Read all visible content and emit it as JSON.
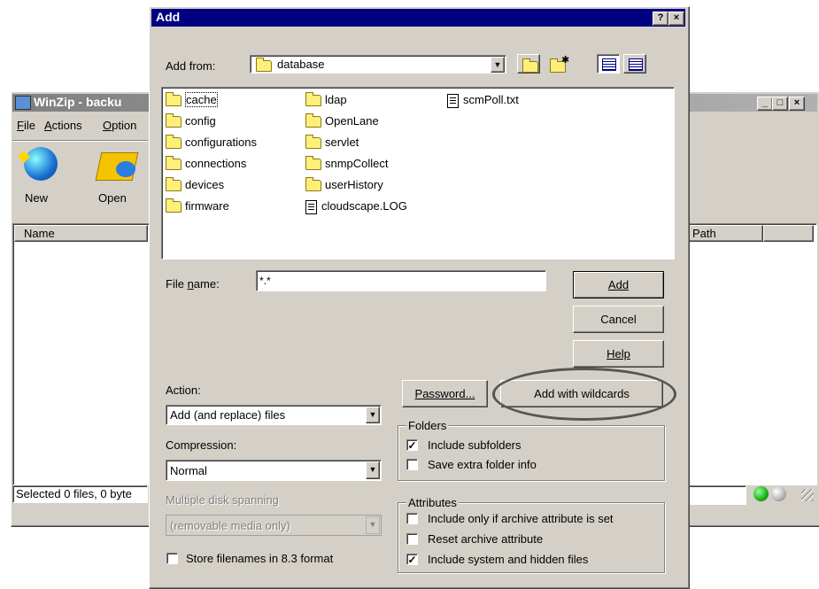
{
  "winzip": {
    "title": "WinZip - backu",
    "menu": [
      "File",
      "Actions",
      "Option"
    ],
    "toolbar": {
      "new_label": "New",
      "open_label": "Open"
    },
    "columns": {
      "name": "Name",
      "path": "Path"
    },
    "status": "Selected 0 files, 0 byte"
  },
  "dialog": {
    "title": "Add",
    "help_btn": "?",
    "close_btn": "×",
    "add_from_label": "Add from:",
    "add_from_value": "database",
    "files": [
      {
        "name": "cache",
        "type": "folder"
      },
      {
        "name": "config",
        "type": "folder"
      },
      {
        "name": "configurations",
        "type": "folder"
      },
      {
        "name": "connections",
        "type": "folder"
      },
      {
        "name": "devices",
        "type": "folder"
      },
      {
        "name": "firmware",
        "type": "folder"
      },
      {
        "name": "ldap",
        "type": "folder"
      },
      {
        "name": "OpenLane",
        "type": "folder"
      },
      {
        "name": "servlet",
        "type": "folder"
      },
      {
        "name": "snmpCollect",
        "type": "folder"
      },
      {
        "name": "userHistory",
        "type": "folder"
      },
      {
        "name": "cloudscape.LOG",
        "type": "file"
      },
      {
        "name": "scmPoll.txt",
        "type": "file"
      }
    ],
    "filename_label": "File name:",
    "filename_value": "*.*",
    "buttons": {
      "add": "Add",
      "cancel": "Cancel",
      "help": "Help",
      "password": "Password...",
      "add_wildcards": "Add with wildcards"
    },
    "action_label": "Action:",
    "action_value": "Add (and replace) files",
    "compression_label": "Compression:",
    "compression_value": "Normal",
    "spanning_label": "Multiple disk spanning",
    "spanning_value": "(removable media only)",
    "store_83_label": "Store filenames in 8.3 format",
    "store_83_checked": false,
    "folders_group": "Folders",
    "include_subfolders": "Include subfolders",
    "include_subfolders_checked": true,
    "save_folder_info": "Save extra folder info",
    "save_folder_info_checked": false,
    "attributes_group": "Attributes",
    "attr_archive_only": "Include only if archive attribute is set",
    "attr_archive_only_checked": false,
    "attr_reset": "Reset archive attribute",
    "attr_reset_checked": false,
    "attr_system_hidden": "Include system and hidden files",
    "attr_system_hidden_checked": true
  },
  "colors": {
    "title_active": "#000080",
    "title_inactive": "#808080",
    "face": "#d4d0c8",
    "highlight_ellipse": "#555555",
    "status_green": "#1db81d"
  }
}
